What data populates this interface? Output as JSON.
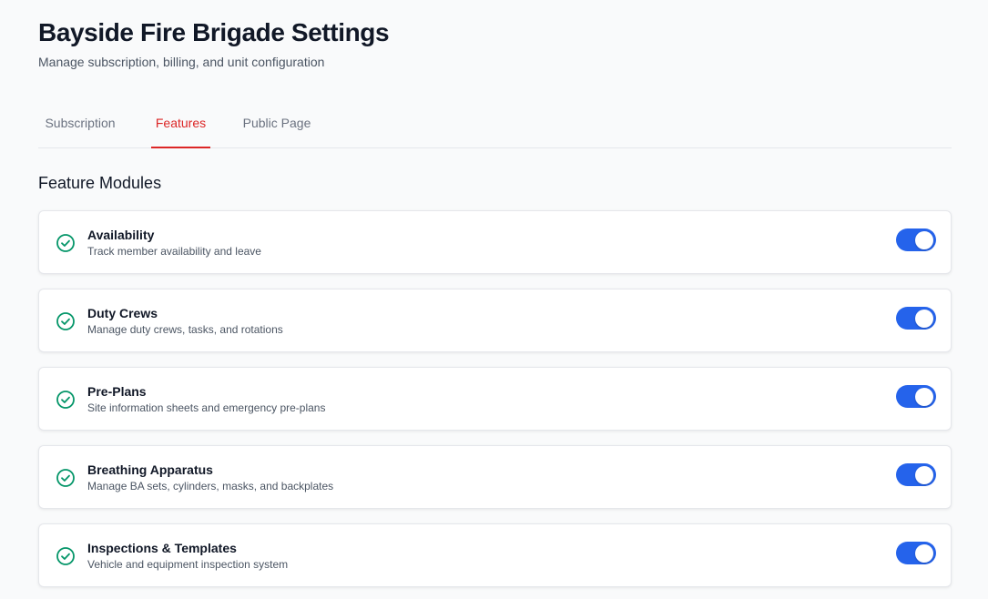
{
  "header": {
    "title": "Bayside Fire Brigade Settings",
    "subtitle": "Manage subscription, billing, and unit configuration"
  },
  "tabs": [
    {
      "label": "Subscription",
      "active": false
    },
    {
      "label": "Features",
      "active": true
    },
    {
      "label": "Public Page",
      "active": false
    }
  ],
  "section": {
    "title": "Feature Modules"
  },
  "features": [
    {
      "name": "Availability",
      "description": "Track member availability and leave",
      "enabled": true,
      "icon": "check-circle-icon"
    },
    {
      "name": "Duty Crews",
      "description": "Manage duty crews, tasks, and rotations",
      "enabled": true,
      "icon": "check-circle-icon"
    },
    {
      "name": "Pre-Plans",
      "description": "Site information sheets and emergency pre-plans",
      "enabled": true,
      "icon": "check-circle-icon"
    },
    {
      "name": "Breathing Apparatus",
      "description": "Manage BA sets, cylinders, masks, and backplates",
      "enabled": true,
      "icon": "check-circle-icon"
    },
    {
      "name": "Inspections & Templates",
      "description": "Vehicle and equipment inspection system",
      "enabled": true,
      "icon": "check-circle-icon"
    }
  ],
  "colors": {
    "accent": "#dc2626",
    "toggle_on": "#2563eb",
    "check": "#059669"
  }
}
